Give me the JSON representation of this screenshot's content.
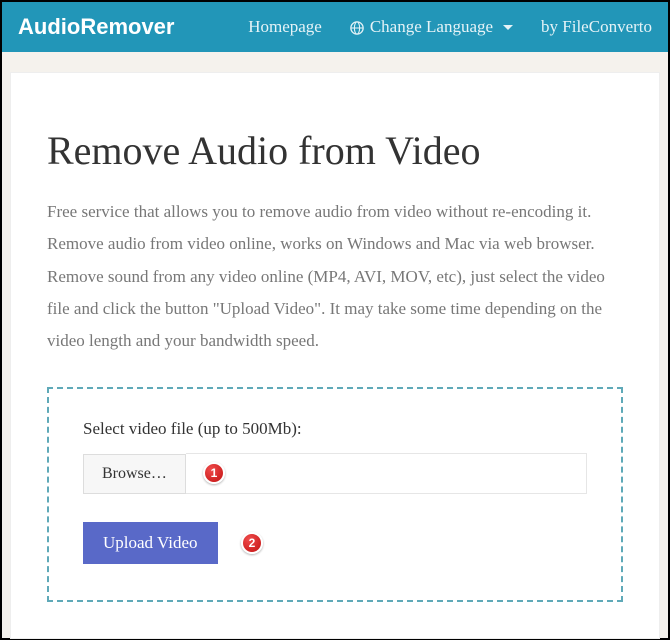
{
  "nav": {
    "brand": "AudioRemover",
    "homepage": "Homepage",
    "changeLanguage": "Change Language",
    "byFileConverto": "by FileConverto"
  },
  "page": {
    "title": "Remove Audio from Video",
    "description": "Free service that allows you to remove audio from video without re-encoding it. Remove audio from video online, works on Windows and Mac via web browser. Remove sound from any video online (MP4, AVI, MOV, etc), just select the video file and click the button \"Upload Video\". It may take some time depending on the video length and your bandwidth speed."
  },
  "upload": {
    "label": "Select video file (up to 500Mb):",
    "browse": "Browse…",
    "filename": "",
    "button": "Upload Video"
  },
  "annotations": {
    "step1": "1",
    "step2": "2"
  }
}
